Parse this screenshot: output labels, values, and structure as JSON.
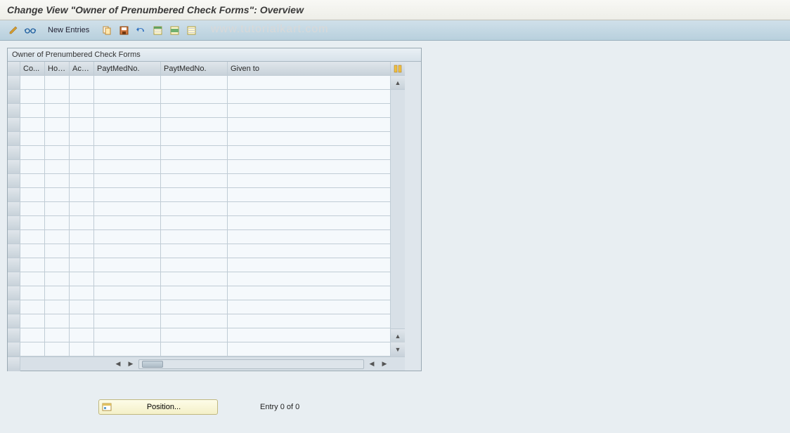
{
  "title": "Change View \"Owner of Prenumbered Check Forms\": Overview",
  "toolbar": {
    "new_entries": "New Entries"
  },
  "watermark": "www.tutorialkart.com",
  "panel": {
    "title": "Owner of Prenumbered Check Forms",
    "columns": [
      "Co...",
      "Hou...",
      "Acc...",
      "PaytMedNo.",
      "PaytMedNo.",
      "Given to"
    ],
    "rows": 20
  },
  "footer": {
    "position": "Position...",
    "entry": "Entry 0 of 0"
  },
  "icons": {
    "pencil": "pencil-icon",
    "glasses": "glasses-icon",
    "copy": "copy-icon",
    "save": "save-icon",
    "undo": "undo-icon",
    "select_all": "select-all-icon",
    "deselect": "deselect-icon",
    "delete": "delete-icon",
    "config": "config-icon"
  }
}
